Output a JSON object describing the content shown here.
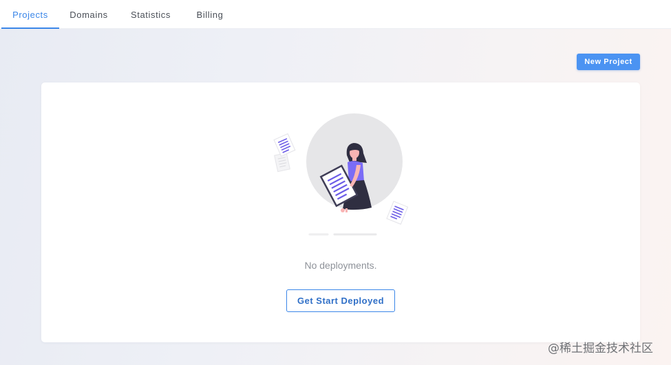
{
  "tabs": [
    {
      "label": "Projects",
      "active": true
    },
    {
      "label": "Domains",
      "active": false
    },
    {
      "label": "Statistics",
      "active": false
    },
    {
      "label": "Billing",
      "active": false
    }
  ],
  "toolbar": {
    "new_project_label": "New Project"
  },
  "empty_state": {
    "illustration": "woman-holding-document-illustration",
    "message": "No deployments.",
    "action_label": "Get Start Deployed"
  },
  "watermark": "@稀土掘金技术社区",
  "colors": {
    "accent": "#3a86e8",
    "button_fill": "#4b93f2",
    "figure_shirt": "#7b6cf6",
    "figure_skirt": "#2f2e41"
  }
}
